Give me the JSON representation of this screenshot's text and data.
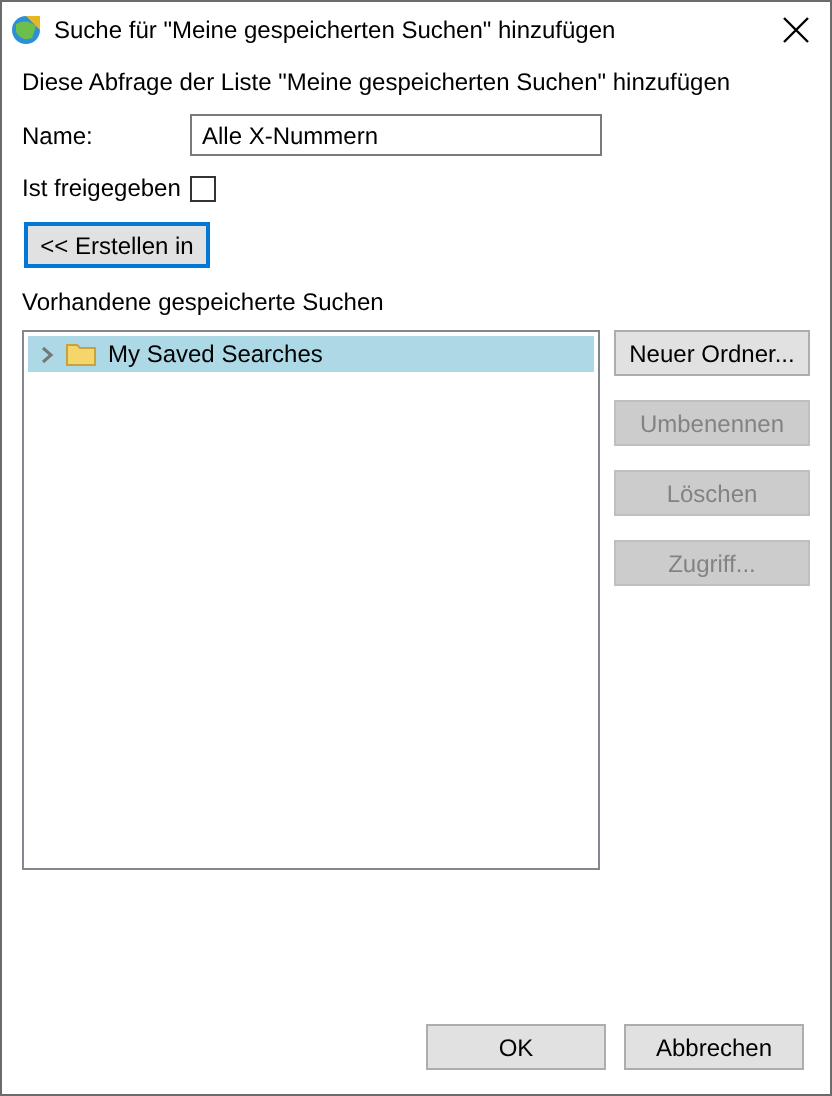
{
  "window": {
    "title": "Suche für \"Meine gespeicherten Suchen\" hinzufügen"
  },
  "intro": "Diese Abfrage der Liste \"Meine gespeicherten Suchen\" hinzufügen",
  "name_field": {
    "label": "Name:",
    "value": "Alle X-Nummern"
  },
  "shared": {
    "label": "Ist freigegeben",
    "checked": false
  },
  "create_in_button": {
    "label": "<< Erstellen in",
    "focused": true
  },
  "tree_label": "Vorhandene gespeicherte Suchen",
  "tree": [
    {
      "label": "My Saved Searches",
      "expanded": false,
      "selected": true
    }
  ],
  "side_buttons": [
    {
      "label": "Neuer Ordner...",
      "disabled": false
    },
    {
      "label": "Umbenennen",
      "disabled": true
    },
    {
      "label": "Löschen",
      "disabled": true
    },
    {
      "label": "Zugriff...",
      "disabled": true
    }
  ],
  "buttons": [
    {
      "label": "OK"
    },
    {
      "label": "Abbrechen"
    }
  ]
}
